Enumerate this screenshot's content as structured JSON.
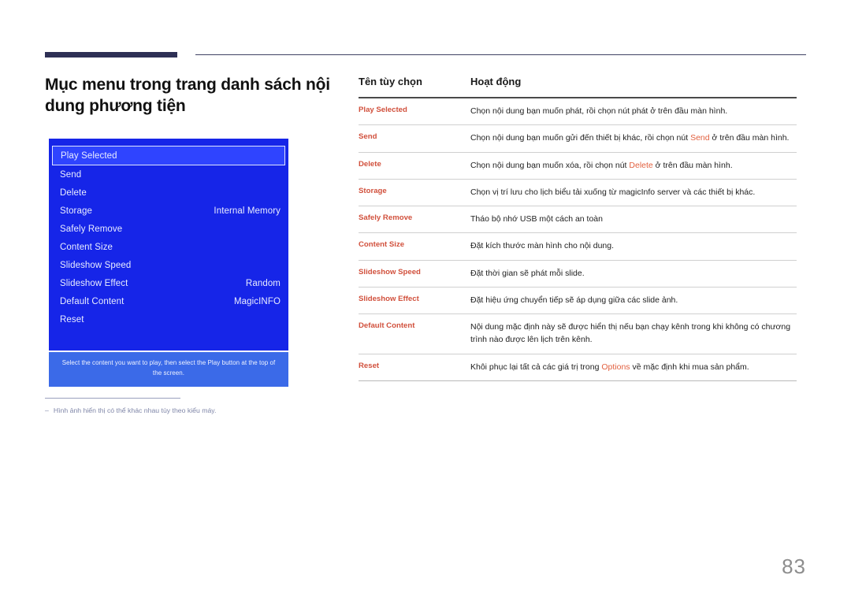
{
  "document": {
    "page_number": "83"
  },
  "left": {
    "title": "Mục menu trong trang danh sách nội dung phương tiện",
    "tv_menu": {
      "items": [
        {
          "label": "Play Selected",
          "value": "",
          "selected": true
        },
        {
          "label": "Send",
          "value": "",
          "selected": false
        },
        {
          "label": "Delete",
          "value": "",
          "selected": false
        },
        {
          "label": "Storage",
          "value": "Internal Memory",
          "selected": false
        },
        {
          "label": "Safely Remove",
          "value": "",
          "selected": false
        },
        {
          "label": "Content Size",
          "value": "",
          "selected": false
        },
        {
          "label": "Slideshow Speed",
          "value": "",
          "selected": false
        },
        {
          "label": "Slideshow Effect",
          "value": "Random",
          "selected": false
        },
        {
          "label": "Default Content",
          "value": "MagicINFO",
          "selected": false
        },
        {
          "label": "Reset",
          "value": "",
          "selected": false
        }
      ],
      "caption": "Select the content you want to play, then select the Play button at the top of the screen."
    },
    "footnote": {
      "dash": "‒",
      "text": "Hình ảnh hiển thị có thể khác nhau tùy theo kiểu máy."
    }
  },
  "table": {
    "headers": [
      "Tên tùy chọn",
      "Hoạt động"
    ],
    "rows": [
      {
        "name": "Play Selected",
        "desc_parts": [
          {
            "text": "Chọn nội dung bạn muốn phát, rồi chọn nút phát ở trên đầu màn hình.",
            "highlight": false
          }
        ]
      },
      {
        "name": "Send",
        "desc_parts": [
          {
            "text": "Chọn nội dung bạn muốn gửi đến thiết bị khác, rồi chọn nút ",
            "highlight": false
          },
          {
            "text": "Send",
            "highlight": true
          },
          {
            "text": " ở trên đầu màn hình.",
            "highlight": false
          }
        ]
      },
      {
        "name": "Delete",
        "desc_parts": [
          {
            "text": "Chọn nội dung bạn muốn xóa, rồi chọn nút ",
            "highlight": false
          },
          {
            "text": "Delete",
            "highlight": true
          },
          {
            "text": " ở trên đầu màn hình.",
            "highlight": false
          }
        ]
      },
      {
        "name": "Storage",
        "desc_parts": [
          {
            "text": "Chọn vị trí lưu cho lịch biểu tải xuống từ magicInfo server và các thiết bị khác.",
            "highlight": false
          }
        ]
      },
      {
        "name": "Safely Remove",
        "desc_parts": [
          {
            "text": "Tháo bộ nhớ USB một cách an toàn",
            "highlight": false
          }
        ]
      },
      {
        "name": "Content Size",
        "desc_parts": [
          {
            "text": "Đặt kích thước màn hình cho nội dung.",
            "highlight": false
          }
        ]
      },
      {
        "name": "Slideshow Speed",
        "desc_parts": [
          {
            "text": "Đặt thời gian sẽ phát mỗi slide.",
            "highlight": false
          }
        ]
      },
      {
        "name": "Slideshow Effect",
        "desc_parts": [
          {
            "text": "Đặt hiệu ứng chuyển tiếp sẽ áp dụng giữa các slide ảnh.",
            "highlight": false
          }
        ]
      },
      {
        "name": "Default Content",
        "desc_parts": [
          {
            "text": "Nội dung mặc định này sẽ được hiển thị nếu bạn chạy kênh trong khi không có chương trình nào được lên lịch trên kênh.",
            "highlight": false
          }
        ]
      },
      {
        "name": "Reset",
        "desc_parts": [
          {
            "text": "Khôi phục lại tất cả các giá trị trong ",
            "highlight": false
          },
          {
            "text": "Options",
            "highlight": true
          },
          {
            "text": " về mặc định khi mua sản phẩm.",
            "highlight": false
          }
        ]
      }
    ]
  },
  "colors": {
    "accent_red": "#d1503c",
    "navy_rule": "#2e3055",
    "tv_blue": "#1625e8",
    "tv_caption_blue": "#3b6ae8",
    "page_number_gray": "#8d8d8d"
  }
}
